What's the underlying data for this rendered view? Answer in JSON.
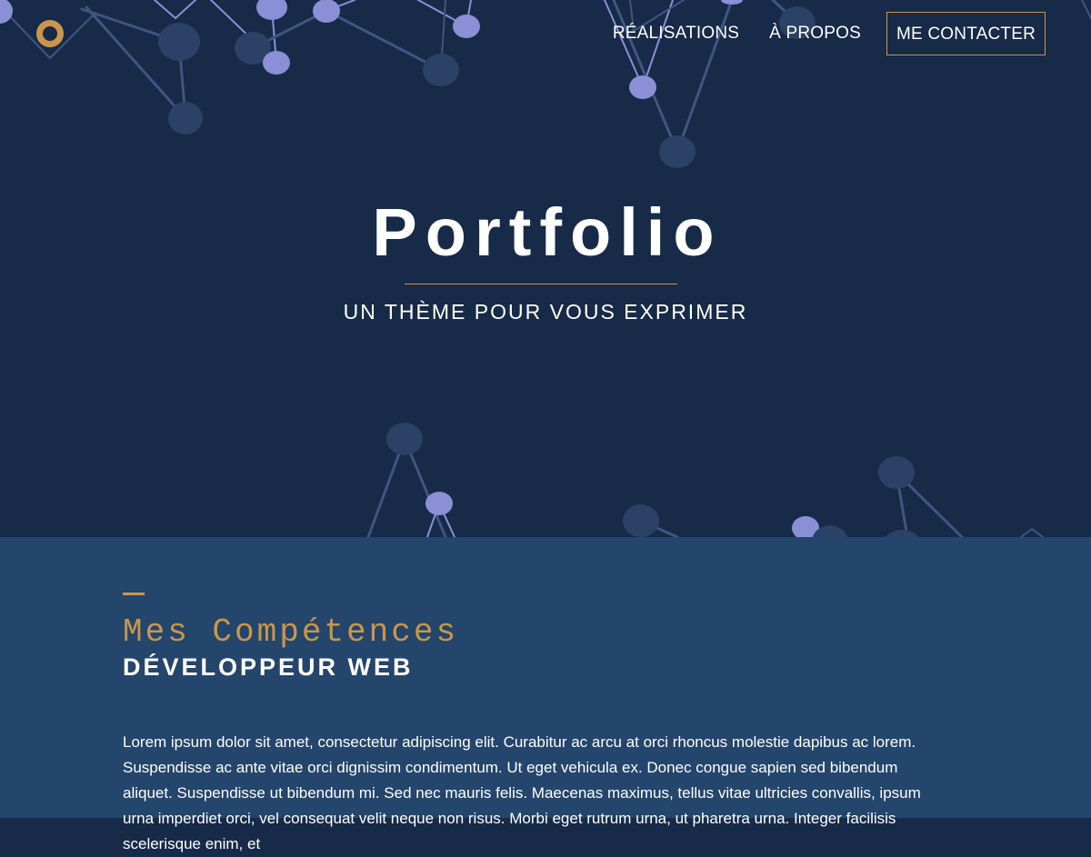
{
  "colors": {
    "hero_background": "#172a48",
    "section_background": "#24456c",
    "accent": "#c9964c",
    "node_light": "#8b8fd6",
    "node_dark": "#2b4166"
  },
  "header": {
    "logo_icon": "ring-logo-icon",
    "nav": [
      {
        "label": "RÉALISATIONS"
      },
      {
        "label": "À PROPOS"
      }
    ],
    "cta_label": "ME CONTACTER"
  },
  "hero": {
    "title": "Portfolio",
    "subtitle": "UN THÈME POUR VOUS EXPRIMER"
  },
  "skills": {
    "heading": "Mes Compétences",
    "subheading": "DÉVELOPPEUR WEB",
    "body": "Lorem ipsum dolor sit amet, consectetur adipiscing elit. Curabitur ac arcu at orci rhoncus molestie dapibus ac lorem. Suspendisse ac ante vitae orci dignissim condimentum. Ut eget vehicula ex. Donec congue sapien sed bibendum aliquet. Suspendisse ut bibendum mi. Sed nec mauris felis. Maecenas maximus, tellus vitae ultricies convallis, ipsum urna imperdiet orci, vel consequat velit neque non risus. Morbi eget rutrum urna, ut pharetra urna. Integer facilisis scelerisque enim, et"
  }
}
